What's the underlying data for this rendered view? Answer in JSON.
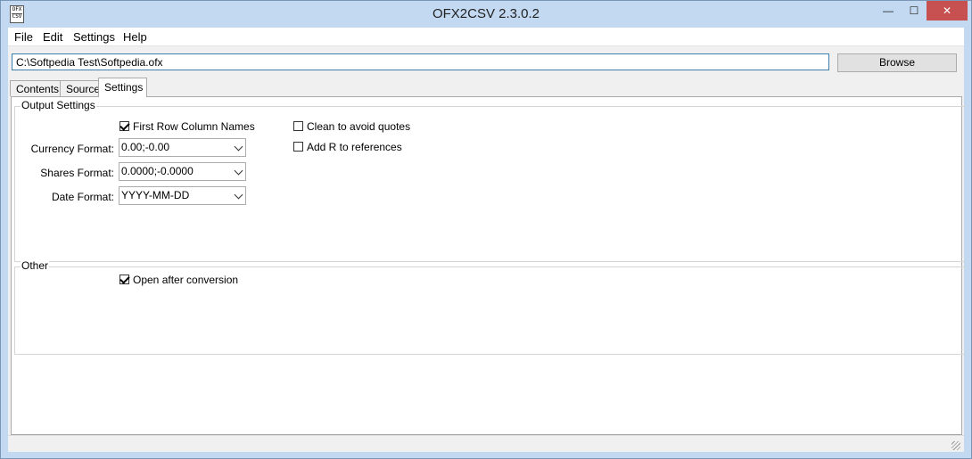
{
  "window": {
    "title": "OFX2CSV 2.3.0.2",
    "icon": {
      "name": "ofx-csv-icon",
      "top_text": "OFX",
      "bottom_text": "CSV"
    },
    "controls": {
      "minimize": "—",
      "maximize": "☐",
      "close": "✕"
    }
  },
  "menubar": {
    "items": [
      "File",
      "Edit",
      "Settings",
      "Help"
    ]
  },
  "file_path": {
    "value": "C:\\Softpedia Test\\Softpedia.ofx"
  },
  "browse_label": "Browse",
  "tabs": [
    {
      "label": "Contents",
      "active": false
    },
    {
      "label": "Source",
      "active": false
    },
    {
      "label": "Settings",
      "active": true
    }
  ],
  "output_settings": {
    "title": "Output Settings",
    "first_row_column_names": {
      "label": "First Row Column Names",
      "checked": true
    },
    "clean_to_avoid_quotes": {
      "label": "Clean to avoid quotes",
      "checked": false
    },
    "add_r_to_references": {
      "label": "Add R to references",
      "checked": false
    },
    "currency_format": {
      "label": "Currency Format:",
      "value": "0.00;-0.00"
    },
    "shares_format": {
      "label": "Shares Format:",
      "value": "0.0000;-0.0000"
    },
    "date_format": {
      "label": "Date Format:",
      "value": "YYYY-MM-DD"
    }
  },
  "other": {
    "title": "Other",
    "open_after_conversion": {
      "label": "Open after conversion",
      "checked": true
    }
  },
  "colors": {
    "title_bar": "#c3d9f1",
    "close_button": "#c75050",
    "input_focus_border": "#3c7fb1"
  }
}
